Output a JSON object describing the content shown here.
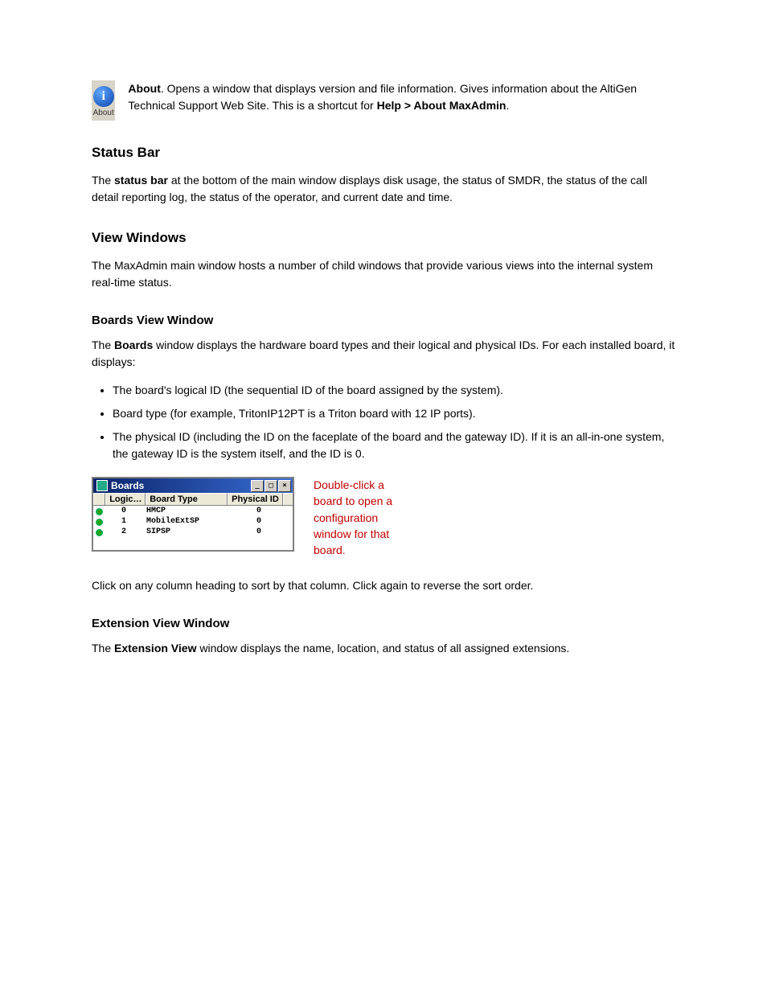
{
  "about": {
    "icon_label": "About",
    "icon_letter": "i",
    "lead_bold": "About",
    "sentence1": ". Opens a window that displays version and file information. Gives information about the AltiGen Technical Support Web Site. This is a shortcut for ",
    "menu_path": "Help > About MaxAdmin",
    "period": "."
  },
  "status_bar": {
    "heading": "Status Bar",
    "p_prefix": "The ",
    "p_bold": "status bar",
    "p_suffix": " at the bottom of the main window displays disk usage, the status of SMDR, the status of the call detail reporting log, the status of the operator, and current date and time."
  },
  "view_windows": {
    "heading": "View Windows",
    "p": "The MaxAdmin main window hosts a number of child windows that provide various views into the internal system real-time status."
  },
  "boards_section": {
    "heading": "Boards View Window",
    "p1_prefix": "The ",
    "p1_bold": "Boards",
    "p1_suffix": " window displays the hardware board types and their logical and physical IDs. For each installed board, it displays:",
    "bullet1": "The board's logical ID (the sequential ID of the board assigned by the system).",
    "bullet2": "Board type (for example, TritonIP12PT is a Triton board with 12 IP ports).",
    "bullet3": "The physical ID (including the ID on the faceplate of the board and the gateway ID). If it is an all-in-one system, the gateway ID is the system itself, and the ID is 0.",
    "window_title": "Boards",
    "columns": {
      "logic": "Logic…",
      "type": "Board Type",
      "phys": "Physical ID"
    },
    "rows": [
      {
        "logic": "0",
        "type": "HMCP",
        "phys": "0"
      },
      {
        "logic": "1",
        "type": "MobileExtSP",
        "phys": "0"
      },
      {
        "logic": "2",
        "type": "SIPSP",
        "phys": "0"
      }
    ],
    "callout": "Double-click a board to open a configuration window for that board.",
    "p_after": "Click on any column heading to sort by that column. Click again to reverse the sort order."
  },
  "ext_section": {
    "heading": "Extension View Window",
    "p_prefix": "The ",
    "p_bold": "Extension View",
    "p_suffix": " window displays the name, location, and status of all assigned extensions."
  },
  "win_btns": {
    "min": "_",
    "max": "□",
    "close": "×"
  }
}
